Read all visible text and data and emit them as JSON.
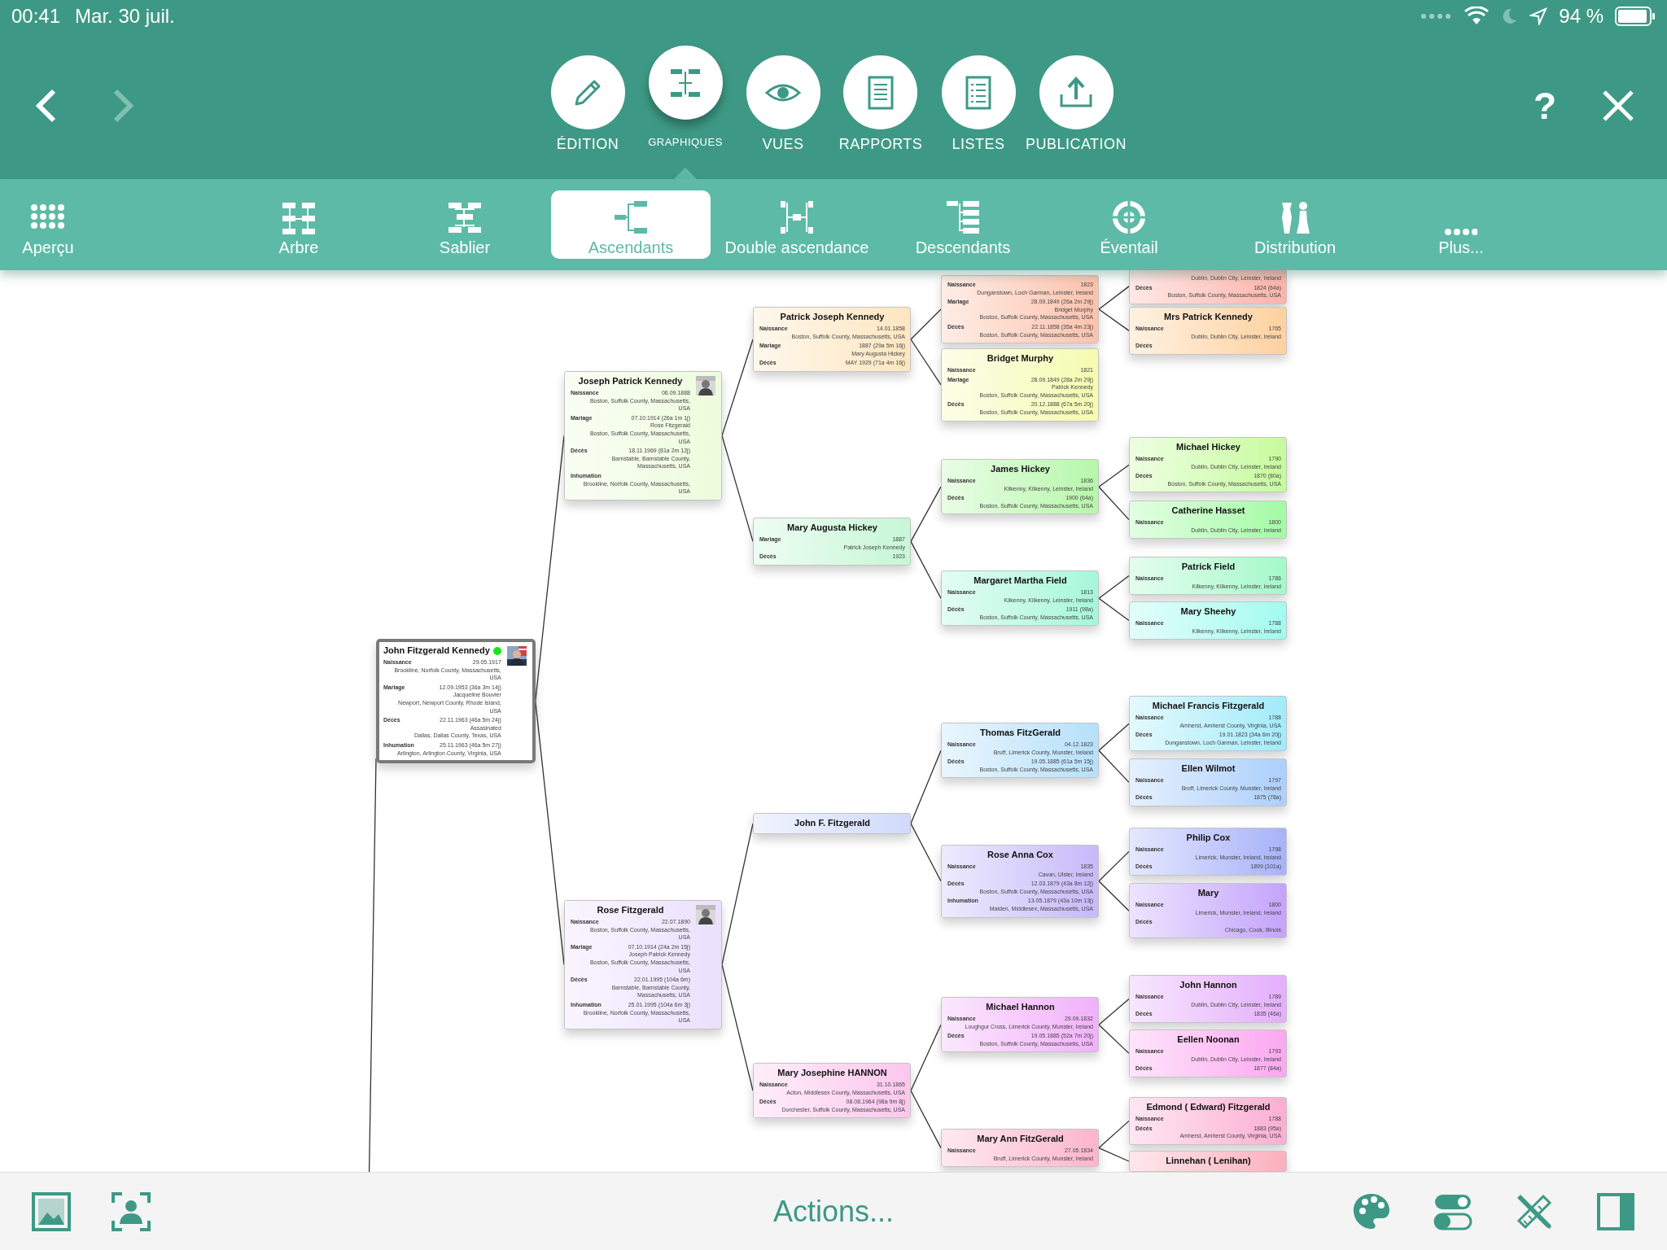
{
  "status_bar": {
    "time": "00:41",
    "date": "Mar. 30 juil.",
    "battery": "94 %"
  },
  "toolbar": {
    "back": {
      "disabled": false
    },
    "forward": {
      "disabled": true
    },
    "buttons": [
      {
        "label": "ÉDITION",
        "selected": false
      },
      {
        "label": "GRAPHIQUES",
        "selected": true
      },
      {
        "label": "VUES",
        "selected": false
      },
      {
        "label": "RAPPORTS",
        "selected": false
      },
      {
        "label": "LISTES",
        "selected": false
      },
      {
        "label": "PUBLICATION",
        "selected": false
      }
    ],
    "help": "?"
  },
  "chart_tabs": [
    {
      "label": "Aperçu",
      "selected": false
    },
    {
      "label": "Arbre",
      "selected": false
    },
    {
      "label": "Sablier",
      "selected": false
    },
    {
      "label": "Ascendants",
      "selected": true
    },
    {
      "label": "Double ascendance",
      "selected": false
    },
    {
      "label": "Descendants",
      "selected": false
    },
    {
      "label": "Éventail",
      "selected": false
    },
    {
      "label": "Distribution",
      "selected": false
    },
    {
      "label": "Plus...",
      "selected": false
    }
  ],
  "tree": {
    "name": "John Fitzgerald Kennedy",
    "selected": true,
    "flagged": true,
    "photo": true,
    "color": "#ffffff",
    "events": [
      {
        "label": "Naissance",
        "value": "29.05.1917",
        "details": [
          "Brookline, Norfolk County, Massachusetts,",
          "USA"
        ]
      },
      {
        "label": "Mariage",
        "value": "12.09.1953 (36a 3m 14j)",
        "details": [
          "Jacqueline Bouvier",
          "Newport, Newport County, Rhode Island,",
          "USA"
        ]
      },
      {
        "label": "Décès",
        "value": "22.11.1963 (46a 5m 24j)",
        "details": [
          "Assasinated",
          "Dallas, Dallas County, Texas, USA"
        ]
      },
      {
        "label": "Inhumation",
        "value": "25.11.1963 (46a 5m 27j)",
        "details": [
          "Arlington, Arlington County, Virginia, USA"
        ]
      }
    ],
    "parents": [
      {
        "name": "Joseph Patrick Kennedy",
        "selected": false,
        "photo": true,
        "color": "#edfcdc",
        "events": [
          {
            "label": "Naissance",
            "value": "06.09.1888",
            "details": [
              "Boston, Suffolk County, Massachusetts,",
              "USA"
            ]
          },
          {
            "label": "Mariage",
            "value": "07.10.1914 (26a 1m 1j)",
            "details": [
              "Rose Fitzgerald",
              "Boston, Suffolk County, Massachusetts,",
              "USA"
            ]
          },
          {
            "label": "Décès",
            "value": "18.11.1969 (81a 2m 12j)",
            "details": [
              "Barnstable, Barnstable County,",
              "Massachusetts, USA"
            ]
          },
          {
            "label": "Inhumation",
            "details": [
              "Brookline, Norfolk County, Massachusetts,",
              "USA"
            ]
          }
        ],
        "parents": [
          {
            "name": "Patrick Joseph Kennedy",
            "selected": false,
            "color": "#fde6c0",
            "events": [
              {
                "label": "Naissance",
                "value": "14.01.1858",
                "details": [
                  "Boston, Suffolk County, Massachusetts, USA"
                ]
              },
              {
                "label": "Mariage",
                "value": "1887 (29a 5m 16j)",
                "details": [
                  "Mary Augusta Hickey"
                ]
              },
              {
                "label": "Décès",
                "value": "MAY 1929 (71a 4m 16j)"
              }
            ],
            "parents": [
              {
                "selected": false,
                "color": "#fdc2ad",
                "events": [
                  {
                    "label": "Naissance",
                    "value": "1823",
                    "details": [
                      "Dunganstown, Loch Garman, Leinster, Ireland"
                    ]
                  },
                  {
                    "label": "Mariage",
                    "value": "28.09.1849 (26a 2m 29j)",
                    "details": [
                      "Bridget Murphy",
                      "Boston, Suffolk County, Massachusetts, USA"
                    ]
                  },
                  {
                    "label": "Décès",
                    "value": "22.11.1858 (35a 4m 23j)",
                    "details": [
                      "Boston, Suffolk County, Massachusetts, USA"
                    ]
                  }
                ],
                "parents": [
                  {
                    "selected": false,
                    "color": "#fdb3aa",
                    "events": [
                      {
                        "details": [
                          "Dublin, Dublin City, Leinster, Ireland"
                        ]
                      },
                      {
                        "label": "Décès",
                        "value": "1824 (64a)",
                        "details": [
                          "Boston, Suffolk County, Massachusetts, USA"
                        ]
                      }
                    ]
                  },
                  {
                    "name": "Mrs Patrick Kennedy",
                    "selected": false,
                    "color": "#fdd19f",
                    "events": [
                      {
                        "label": "Naissance",
                        "value": "1765",
                        "details": [
                          "Dublin, Dublin City, Leinster, Ireland"
                        ]
                      },
                      {
                        "label": "Décès"
                      }
                    ]
                  }
                ]
              },
              {
                "name": "Bridget Murphy",
                "selected": false,
                "color": "#f5fbb0",
                "events": [
                  {
                    "label": "Naissance",
                    "value": "1821"
                  },
                  {
                    "label": "Mariage",
                    "value": "28.09.1849 (28a 2m 29j)",
                    "details": [
                      "Patrick Kennedy",
                      "Boston, Suffolk County, Massachusetts, USA"
                    ]
                  },
                  {
                    "label": "Décès",
                    "value": "20.12.1888 (67a 5m 20j)",
                    "details": [
                      "Boston, Suffolk County, Massachusetts, USA"
                    ]
                  }
                ]
              }
            ]
          },
          {
            "name": "Mary Augusta Hickey",
            "selected": false,
            "color": "#c6f7d6",
            "events": [
              {
                "label": "Mariage",
                "value": "1887",
                "details": [
                  "Patrick Joseph Kennedy"
                ]
              },
              {
                "label": "Décès",
                "value": "1923"
              }
            ],
            "parents": [
              {
                "name": "James Hickey",
                "selected": false,
                "color": "#b6f7aa",
                "events": [
                  {
                    "label": "Naissance",
                    "value": "1836",
                    "details": [
                      "Kilkenny, Kilkenny, Leinster, Ireland"
                    ]
                  },
                  {
                    "label": "Décès",
                    "value": "1900 (64a)",
                    "details": [
                      "Boston, Suffolk County, Massachusetts, USA"
                    ]
                  }
                ],
                "parents": [
                  {
                    "name": "Michael Hickey",
                    "selected": false,
                    "color": "#c6fb9c",
                    "events": [
                      {
                        "label": "Naissance",
                        "value": "1790",
                        "details": [
                          "Dublin, Dublin City, Leinster, Ireland"
                        ]
                      },
                      {
                        "label": "Décès",
                        "value": "1870 (80a)",
                        "details": [
                          "Boston, Suffolk County, Massachusetts, USA"
                        ]
                      }
                    ]
                  },
                  {
                    "name": "Catherine Hasset",
                    "selected": false,
                    "color": "#a2fba4",
                    "events": [
                      {
                        "label": "Naissance",
                        "value": "1800",
                        "details": [
                          "Dublin, Dublin City, Leinster, Ireland"
                        ]
                      }
                    ]
                  }
                ]
              },
              {
                "name": "Margaret Martha Field",
                "selected": false,
                "color": "#a4f7da",
                "events": [
                  {
                    "label": "Naissance",
                    "value": "1813",
                    "details": [
                      "Kilkenny, Kilkenny, Leinster, Ireland"
                    ]
                  },
                  {
                    "label": "Décès",
                    "value": "1911 (98a)",
                    "details": [
                      "Boston, Suffolk County, Massachusetts, USA"
                    ]
                  }
                ],
                "parents": [
                  {
                    "name": "Patrick Field",
                    "selected": false,
                    "color": "#a4f9c9",
                    "events": [
                      {
                        "label": "Naissance",
                        "value": "1786",
                        "details": [
                          "Kilkenny, Kilkenny, Leinster, Ireland"
                        ]
                      }
                    ]
                  },
                  {
                    "name": "Mary Sheehy",
                    "selected": false,
                    "color": "#a0fbef",
                    "events": [
                      {
                        "label": "Naissance",
                        "value": "1788",
                        "details": [
                          "Kilkenny, Kilkenny, Leinster, Ireland"
                        ]
                      }
                    ]
                  }
                ]
              }
            ]
          }
        ]
      },
      {
        "name": "Rose Fitzgerald",
        "selected": false,
        "photo": true,
        "color": "#ebe0fd",
        "events": [
          {
            "label": "Naissance",
            "value": "22.07.1890",
            "details": [
              "Boston, Suffolk County, Massachusetts,",
              "USA"
            ]
          },
          {
            "label": "Mariage",
            "value": "07.10.1914 (24a 2m 15j)",
            "details": [
              "Joseph Patrick Kennedy",
              "Boston, Suffolk County, Massachusetts,",
              "USA"
            ]
          },
          {
            "label": "Décès",
            "value": "22.01.1995 (104a 6m)",
            "details": [
              "Barnstable, Barnstable County,",
              "Massachusetts, USA"
            ]
          },
          {
            "label": "Inhumation",
            "value": "25.01.1995 (104a 6m 3j)",
            "details": [
              "Brookline, Norfolk County, Massachusetts,",
              "USA"
            ]
          }
        ],
        "parents": [
          {
            "name": "John F. Fitzgerald",
            "selected": false,
            "color": "#d0dafb",
            "parents": [
              {
                "name": "Thomas FitzGerald",
                "selected": false,
                "color": "#b6e0fb",
                "events": [
                  {
                    "label": "Naissance",
                    "value": "04.12.1823",
                    "details": [
                      "Bruff, Limerick County, Munster, Ireland"
                    ]
                  },
                  {
                    "label": "Décès",
                    "value": "19.05.1885 (61a 5m 15j)",
                    "details": [
                      "Boston, Suffolk County, Massachusetts, USA"
                    ]
                  }
                ],
                "parents": [
                  {
                    "name": "Michael Francis Fitzgerald",
                    "selected": false,
                    "color": "#a2ebfb",
                    "events": [
                      {
                        "label": "Naissance",
                        "value": "1788",
                        "details": [
                          "Amherst, Amherst County, Virginia, USA"
                        ]
                      },
                      {
                        "label": "Décès",
                        "value": "19.01.1823 (34a 6m 20j)",
                        "details": [
                          "Dunganstown, Loch Garman, Leinster, Ireland"
                        ]
                      }
                    ]
                  },
                  {
                    "name": "Ellen Wilmot",
                    "selected": false,
                    "color": "#accffb",
                    "events": [
                      {
                        "label": "Naissance",
                        "value": "1797",
                        "details": [
                          "Bruff, Limerick County, Munster, Ireland"
                        ]
                      },
                      {
                        "label": "Décès",
                        "value": "1875 (78a)"
                      }
                    ]
                  }
                ]
              },
              {
                "name": "Rose Anna Cox",
                "selected": false,
                "color": "#c6bafa",
                "events": [
                  {
                    "label": "Naissance",
                    "value": "1835",
                    "details": [
                      "Cavan, Ulster, Ireland"
                    ]
                  },
                  {
                    "label": "Décès",
                    "value": "12.03.1879 (43a 8m 12j)",
                    "details": [
                      "Boston, Suffolk County, Massachusetts, USA"
                    ]
                  },
                  {
                    "label": "Inhumation",
                    "value": "13.05.1879 (43a 10m 13j)",
                    "details": [
                      "Malden, Middlesex, Massachusetts, USA"
                    ]
                  }
                ],
                "parents": [
                  {
                    "name": "Philip Cox",
                    "selected": false,
                    "color": "#a8b2f9",
                    "events": [
                      {
                        "label": "Naissance",
                        "value": "1798",
                        "details": [
                          "Limerick, Munster, Ireland, Ireland"
                        ]
                      },
                      {
                        "label": "Décès",
                        "value": "1899 (101a)"
                      }
                    ]
                  },
                  {
                    "name": "Mary",
                    "selected": false,
                    "color": "#c4a4fb",
                    "events": [
                      {
                        "label": "Naissance",
                        "value": "1800",
                        "details": [
                          "Limerick, Munster, Ireland, Ireland"
                        ]
                      },
                      {
                        "label": "Décès",
                        "details": [
                          "Chicago, Cook, Illinois"
                        ]
                      }
                    ]
                  }
                ]
              }
            ]
          },
          {
            "name": "Mary Josephine HANNON",
            "selected": false,
            "color": "#fcc6ed",
            "events": [
              {
                "label": "Naissance",
                "value": "31.10.1865",
                "details": [
                  "Acton, Middlesex County, Massachusetts, USA"
                ]
              },
              {
                "label": "Décès",
                "value": "08.08.1964 (98a 9m 8j)",
                "details": [
                  "Dorchester, Suffolk County, Massachusetts, USA"
                ]
              }
            ],
            "parents": [
              {
                "name": "Michael Hannon",
                "selected": false,
                "color": "#f2b0fb",
                "events": [
                  {
                    "label": "Naissance",
                    "value": "29.09.1832",
                    "details": [
                      "Loughgur Cross, Limerick County, Munster, Ireland"
                    ]
                  },
                  {
                    "label": "Décès",
                    "value": "19.05.1885 (52a 7m 20j)",
                    "details": [
                      "Boston, Suffolk County, Massachusetts, USA"
                    ]
                  }
                ],
                "parents": [
                  {
                    "name": "John Hannon",
                    "selected": false,
                    "color": "#e4aefb",
                    "events": [
                      {
                        "label": "Naissance",
                        "value": "1789",
                        "details": [
                          "Dublin, Dublin City, Leinster, Ireland"
                        ]
                      },
                      {
                        "label": "Décès",
                        "value": "1835 (46a)"
                      }
                    ]
                  },
                  {
                    "name": "Eellen Noonan",
                    "selected": false,
                    "color": "#fba7f0",
                    "events": [
                      {
                        "label": "Naissance",
                        "value": "1793",
                        "details": [
                          "Dublin, Dublin City, Leinster, Ireland"
                        ]
                      },
                      {
                        "label": "Décès",
                        "value": "1877 (84a)"
                      }
                    ]
                  }
                ]
              },
              {
                "name": "Mary Ann FitzGerald",
                "selected": false,
                "color": "#fbb5cd",
                "events": [
                  {
                    "label": "Naissance",
                    "value": "27.05.1834",
                    "details": [
                      "Bruff, Limerick County, Munster, Ireland"
                    ]
                  }
                ],
                "parents": [
                  {
                    "name": "Edmond ( Edward) Fitzgerald",
                    "selected": false,
                    "color": "#fbaed2",
                    "events": [
                      {
                        "label": "Naissance",
                        "value": "1788"
                      },
                      {
                        "label": "Décès",
                        "value": "1883 (95a)",
                        "details": [
                          "Amherst, Amherst County, Virginia, USA"
                        ]
                      }
                    ]
                  },
                  {
                    "name": "Linnehan ( Lenihan)",
                    "selected": false,
                    "color": "#fbb0bd"
                  }
                ]
              }
            ]
          }
        ]
      }
    ]
  },
  "bottom_bar": {
    "actions": "Actions..."
  }
}
